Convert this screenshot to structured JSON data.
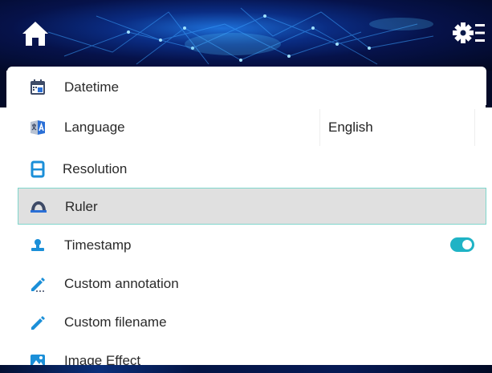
{
  "header": {
    "home_icon": "home-icon",
    "settings_icon": "settings-list-icon"
  },
  "menu": {
    "items": [
      {
        "label": "Datetime",
        "icon": "calendar-icon"
      },
      {
        "label": "Language",
        "icon": "translate-icon",
        "value": "English"
      },
      {
        "label": "Resolution",
        "icon": "film-icon"
      },
      {
        "label": "Ruler",
        "icon": "ruler-icon",
        "selected": true
      },
      {
        "label": "Timestamp",
        "icon": "stamp-icon",
        "toggle": true
      },
      {
        "label": "Custom annotation",
        "icon": "pencil-dots-icon"
      },
      {
        "label": "Custom filename",
        "icon": "pencil-icon"
      },
      {
        "label": "Image Effect",
        "icon": "image-icon"
      }
    ]
  },
  "colors": {
    "accent": "#1fb3c5",
    "selected_bg": "#e0e0e0",
    "selected_border": "#7fd6cc",
    "header_bg": "#06124a"
  }
}
